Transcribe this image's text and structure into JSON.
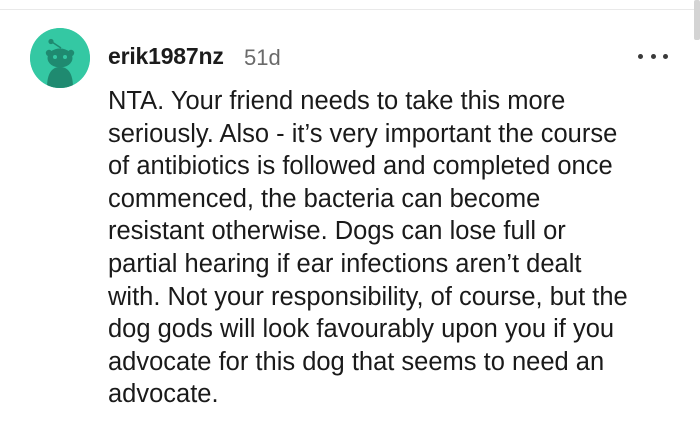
{
  "comment": {
    "author": "erik1987nz",
    "age": "51d",
    "avatar_icon": "reddit-snoo-avatar-icon",
    "avatar_color": "#34c8a3",
    "more_icon": "more-options-icon",
    "body": "NTA. Your friend needs to take this more\nseriously. Also - it’s very important the course\nof antibiotics is followed and completed once\ncommenced, the bacteria can become\nresistant otherwise. Dogs can lose full or\npartial hearing if ear infections aren’t dealt\nwith. Not your responsibility, of course, but the\ndog gods will look favourably upon you if you\nadvocate for this dog that seems to need an\nadvocate."
  }
}
